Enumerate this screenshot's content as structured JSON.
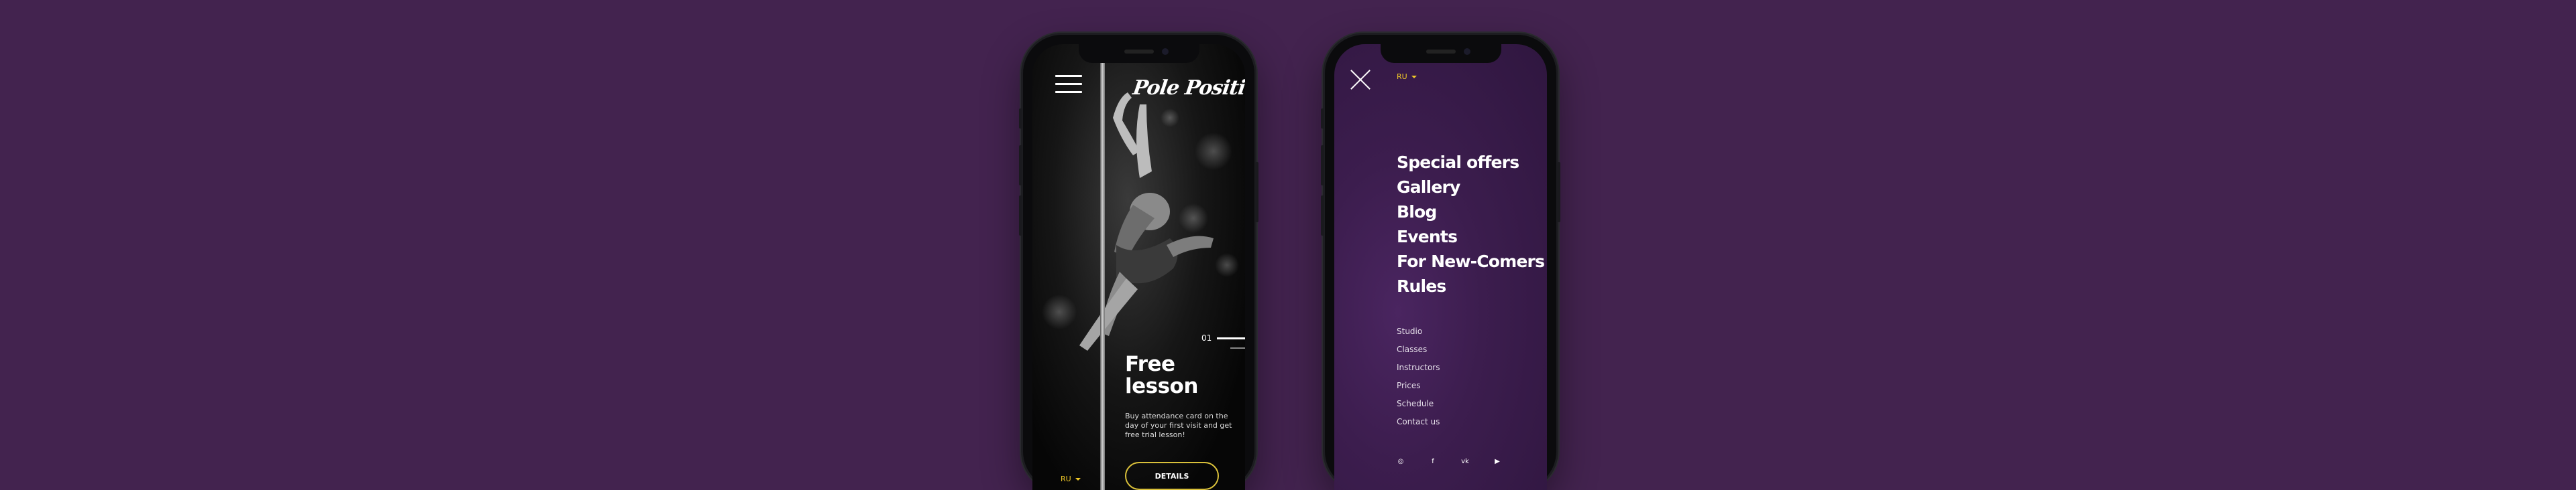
{
  "colors": {
    "background": "#43234f",
    "accent": "#d9c03a",
    "lang_accent": "#f0c928"
  },
  "phone_home": {
    "menu_icon": "hamburger-menu-icon",
    "logo_text": "Pole Position",
    "slide_number": "01",
    "hero_title": "Free lesson",
    "hero_description": "Buy attendance card on the day of your first visit and get free trial lesson!",
    "details_label": "DETAILS",
    "language": "RU"
  },
  "phone_menu": {
    "close_icon": "close-icon",
    "language": "RU",
    "main_menu": [
      "Special offers",
      "Gallery",
      "Blog",
      "Events",
      "For New-Comers",
      "Rules"
    ],
    "sub_menu": [
      "Studio",
      "Classes",
      "Instructors",
      "Prices",
      "Schedule",
      "Contact us"
    ],
    "socials": [
      {
        "icon": "instagram-icon",
        "glyph": "◎"
      },
      {
        "icon": "facebook-icon",
        "glyph": "f"
      },
      {
        "icon": "vk-icon",
        "glyph": "vk"
      },
      {
        "icon": "youtube-icon",
        "glyph": "▶"
      }
    ]
  }
}
